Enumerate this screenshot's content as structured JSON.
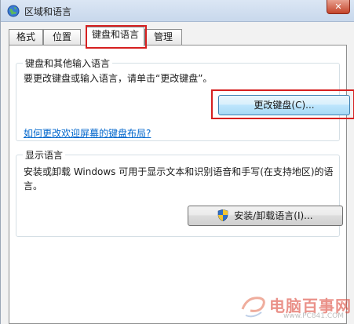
{
  "window": {
    "title": "区域和语言",
    "close_label": "✕"
  },
  "tabs": [
    {
      "label": "格式",
      "active": false
    },
    {
      "label": "位置",
      "active": false
    },
    {
      "label": "键盘和语言",
      "active": true
    },
    {
      "label": "管理",
      "active": false
    }
  ],
  "keyboard_group": {
    "label": "键盘和其他输入语言",
    "instruction": "要更改键盘或输入语言，请单击“更改键盘”。",
    "change_button": "更改键盘(C)...",
    "link": "如何更改欢迎屏幕的键盘布局?"
  },
  "display_group": {
    "label": "显示语言",
    "line1": "安装或卸载 Windows 可用于显示文本和识别语音和手写(在支持地区)的语",
    "line2": "言。",
    "install_button": "安装/卸载语言(I)..."
  },
  "watermark": {
    "text": "电脑百事网",
    "url": "www.PC841.COM"
  },
  "colors": {
    "highlight": "#d62020",
    "link": "#0066cc"
  }
}
